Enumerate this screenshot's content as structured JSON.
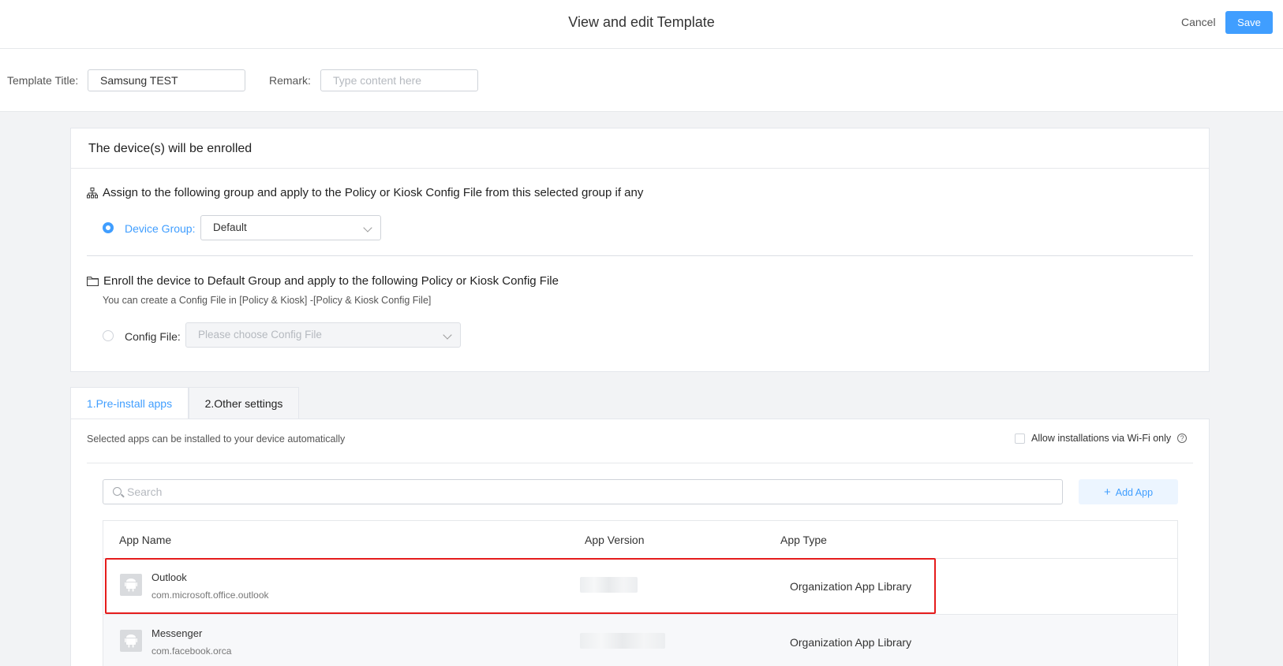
{
  "header": {
    "title": "View and edit Template",
    "cancel_label": "Cancel",
    "save_label": "Save"
  },
  "template": {
    "title_label": "Template Title:",
    "title_value": "Samsung TEST",
    "remark_label": "Remark:",
    "remark_placeholder": "Type content here"
  },
  "enroll": {
    "section_title": "The device(s) will be enrolled",
    "option1_heading": "Assign to the following group and apply to the Policy or Kiosk Config File from this selected group if any",
    "device_group_label": "Device Group:",
    "device_group_value": "Default",
    "option2_heading": "Enroll the device to Default Group and apply to the following Policy or Kiosk Config File",
    "option2_hint": "You can create a Config File in [Policy & Kiosk] -[Policy & Kiosk Config File]",
    "config_file_label": "Config File:",
    "config_file_placeholder": "Please choose Config File"
  },
  "tabs": [
    {
      "label": "1.Pre-install apps",
      "active": true
    },
    {
      "label": "2.Other settings",
      "active": false
    }
  ],
  "apps": {
    "description": "Selected apps can be installed to your device automatically",
    "wifi_label": "Allow installations via Wi-Fi only",
    "search_placeholder": "Search",
    "add_app_label": "Add App",
    "columns": [
      "App Name",
      "App Version",
      "App Type"
    ],
    "rows": [
      {
        "name": "Outlook",
        "package": "com.microsoft.office.outlook",
        "type": "Organization App Library"
      },
      {
        "name": "Messenger",
        "package": "com.facebook.orca",
        "type": "Organization App Library"
      }
    ]
  },
  "colors": {
    "accent": "#409eff",
    "highlight": "#e51c1c"
  }
}
